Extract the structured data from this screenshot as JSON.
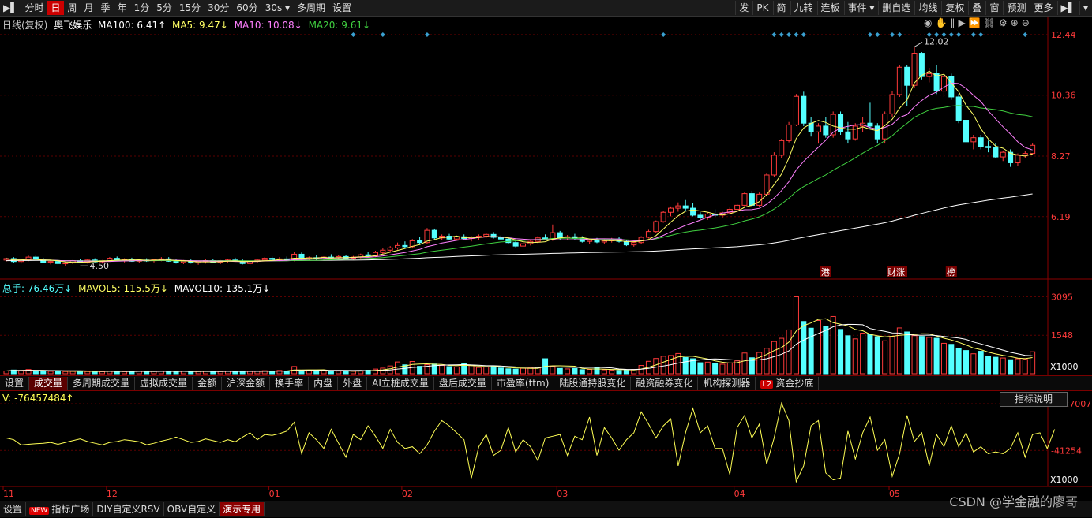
{
  "toolbar": {
    "left": [
      {
        "label": "▶▌",
        "icon": "replay-icon"
      },
      {
        "label": "分时"
      },
      {
        "label": "日",
        "active": true
      },
      {
        "label": "周"
      },
      {
        "label": "月"
      },
      {
        "label": "季"
      },
      {
        "label": "年"
      },
      {
        "label": "1分"
      },
      {
        "label": "5分"
      },
      {
        "label": "15分"
      },
      {
        "label": "30分"
      },
      {
        "label": "60分"
      },
      {
        "label": "30s ▾"
      },
      {
        "label": "多周期"
      },
      {
        "label": "设置"
      }
    ],
    "right": [
      {
        "label": "发"
      },
      {
        "label": "PK"
      },
      {
        "label": "简"
      },
      {
        "label": "九转"
      },
      {
        "label": "连板"
      },
      {
        "label": "事件 ▾"
      },
      {
        "label": "删自选"
      },
      {
        "label": "均线"
      },
      {
        "label": "复权"
      },
      {
        "label": "叠"
      },
      {
        "label": "窗"
      },
      {
        "label": "预测"
      },
      {
        "label": "更多"
      },
      {
        "label": "▶▌"
      },
      {
        "label": "▾"
      }
    ]
  },
  "main_info": {
    "period": "日线(复权)",
    "stock": "奥飞娱乐",
    "ma100": "MA100: 6.41↑",
    "ma5": "MA5: 9.47↓",
    "ma10": "MA10: 10.08↓",
    "ma20": "MA20: 9.61↓"
  },
  "volume_info": {
    "total": "总手: 76.46万↓",
    "mavol5": "MAVOL5: 115.5万↓",
    "mavol10": "MAVOL10: 135.1万↓"
  },
  "indicator_info": {
    "v": "V: -76457484↑"
  },
  "price_axis": [
    "12.44",
    "10.36",
    "8.27",
    "6.19"
  ],
  "volume_axis": [
    "3095",
    "1548",
    "X1000"
  ],
  "indicator_axis": [
    "+227007",
    "-41254",
    "X1000"
  ],
  "date_axis": [
    "11",
    "12",
    "01",
    "02",
    "03",
    "04",
    "05"
  ],
  "annotations": {
    "high": "12.02",
    "low": "4.50",
    "events": [
      "港",
      "财涨",
      "榜"
    ]
  },
  "tabs": [
    {
      "label": "设置"
    },
    {
      "label": "成交量",
      "active": true
    },
    {
      "label": "多周期成交量"
    },
    {
      "label": "虚拟成交量"
    },
    {
      "label": "金额"
    },
    {
      "label": "沪深金额"
    },
    {
      "label": "换手率"
    },
    {
      "label": "内盘"
    },
    {
      "label": "外盘"
    },
    {
      "label": "AI立桩成交量"
    },
    {
      "label": "盘后成交量"
    },
    {
      "label": "市盈率(ttm)"
    },
    {
      "label": "陆股通持股变化"
    },
    {
      "label": "融资融券变化"
    },
    {
      "label": "机构探测器"
    },
    {
      "label": "资金抄底",
      "badge": "L2"
    }
  ],
  "indicator_button": "指标说明",
  "bottom_tabs": [
    {
      "label": "设置"
    },
    {
      "label": "指标广场",
      "badge": "NEW"
    },
    {
      "label": "DIY自定义RSV"
    },
    {
      "label": "OBV自定义"
    },
    {
      "label": "演示专用",
      "active": true
    }
  ],
  "watermark": "CSDN @学金融的廖哥",
  "colors": {
    "up": "#ff3a3a",
    "down": "#54ffff",
    "ma5": "#ffff64",
    "ma10": "#ff80ff",
    "ma20": "#40d040",
    "ma100": "#ffffff",
    "axis": "#8b0000",
    "indicator": "#ffff55",
    "marker": "#3aa0d0"
  },
  "chart_data": {
    "type": "candlestick",
    "price_ylim": [
      4.1,
      12.6
    ],
    "volume_ylim": [
      0,
      3300
    ],
    "indicator_ylim": [
      -230000,
      227007
    ],
    "candles": [
      [
        4.7,
        4.78,
        4.65,
        4.75
      ],
      [
        4.75,
        4.8,
        4.6,
        4.65
      ],
      [
        4.65,
        4.72,
        4.58,
        4.7
      ],
      [
        4.7,
        4.85,
        4.66,
        4.8
      ],
      [
        4.8,
        4.88,
        4.7,
        4.72
      ],
      [
        4.72,
        4.78,
        4.6,
        4.62
      ],
      [
        4.62,
        4.68,
        4.55,
        4.65
      ],
      [
        4.65,
        4.7,
        4.55,
        4.58
      ],
      [
        4.58,
        4.64,
        4.5,
        4.6
      ],
      [
        4.6,
        4.7,
        4.56,
        4.68
      ],
      [
        4.68,
        4.74,
        4.6,
        4.62
      ],
      [
        4.62,
        4.72,
        4.58,
        4.7
      ],
      [
        4.7,
        4.76,
        4.62,
        4.64
      ],
      [
        4.64,
        4.7,
        4.58,
        4.68
      ],
      [
        4.68,
        4.8,
        4.64,
        4.76
      ],
      [
        4.76,
        4.82,
        4.66,
        4.7
      ],
      [
        4.7,
        4.76,
        4.62,
        4.72
      ],
      [
        4.72,
        4.78,
        4.64,
        4.66
      ],
      [
        4.66,
        4.74,
        4.6,
        4.7
      ],
      [
        4.7,
        4.76,
        4.64,
        4.68
      ],
      [
        4.68,
        4.74,
        4.62,
        4.72
      ],
      [
        4.72,
        4.8,
        4.66,
        4.74
      ],
      [
        4.74,
        4.8,
        4.64,
        4.66
      ],
      [
        4.66,
        4.72,
        4.58,
        4.62
      ],
      [
        4.62,
        4.7,
        4.56,
        4.66
      ],
      [
        4.66,
        4.72,
        4.58,
        4.6
      ],
      [
        4.6,
        4.68,
        4.54,
        4.64
      ],
      [
        4.64,
        4.72,
        4.58,
        4.68
      ],
      [
        4.68,
        4.74,
        4.6,
        4.62
      ],
      [
        4.62,
        4.7,
        4.56,
        4.68
      ],
      [
        4.68,
        4.75,
        4.62,
        4.7
      ],
      [
        4.7,
        4.78,
        4.64,
        4.66
      ],
      [
        4.66,
        4.72,
        4.55,
        4.58
      ],
      [
        4.58,
        4.68,
        4.52,
        4.66
      ],
      [
        4.66,
        4.74,
        4.6,
        4.7
      ],
      [
        4.7,
        4.8,
        4.66,
        4.76
      ],
      [
        4.76,
        4.82,
        4.68,
        4.72
      ],
      [
        4.72,
        4.8,
        4.66,
        4.74
      ],
      [
        4.74,
        4.82,
        4.68,
        4.7
      ],
      [
        4.7,
        4.98,
        4.66,
        4.9
      ],
      [
        4.9,
        4.96,
        4.7,
        4.74
      ],
      [
        4.74,
        4.82,
        4.68,
        4.78
      ],
      [
        4.78,
        4.86,
        4.7,
        4.74
      ],
      [
        4.74,
        4.82,
        4.68,
        4.8
      ],
      [
        4.8,
        4.9,
        4.74,
        4.78
      ],
      [
        4.78,
        4.86,
        4.7,
        4.82
      ],
      [
        4.82,
        4.88,
        4.74,
        4.76
      ],
      [
        4.76,
        4.84,
        4.7,
        4.8
      ],
      [
        4.8,
        4.92,
        4.76,
        4.88
      ],
      [
        4.88,
        4.98,
        4.8,
        4.84
      ],
      [
        4.84,
        5.02,
        4.8,
        4.96
      ],
      [
        4.96,
        5.1,
        4.9,
        5.04
      ],
      [
        5.04,
        5.18,
        4.98,
        5.12
      ],
      [
        5.12,
        5.3,
        5.06,
        5.2
      ],
      [
        5.2,
        5.34,
        5.1,
        5.16
      ],
      [
        5.16,
        5.42,
        5.1,
        5.36
      ],
      [
        5.36,
        5.5,
        5.24,
        5.3
      ],
      [
        5.3,
        5.8,
        5.26,
        5.72
      ],
      [
        5.72,
        5.78,
        5.4,
        5.46
      ],
      [
        5.46,
        5.58,
        5.38,
        5.52
      ],
      [
        5.52,
        5.6,
        5.38,
        5.42
      ],
      [
        5.42,
        5.54,
        5.36,
        5.5
      ],
      [
        5.5,
        5.58,
        5.4,
        5.44
      ],
      [
        5.44,
        5.52,
        5.34,
        5.48
      ],
      [
        5.48,
        5.58,
        5.4,
        5.52
      ],
      [
        5.52,
        5.64,
        5.46,
        5.58
      ],
      [
        5.58,
        5.66,
        5.44,
        5.48
      ],
      [
        5.48,
        5.56,
        5.38,
        5.42
      ],
      [
        5.42,
        5.5,
        5.26,
        5.3
      ],
      [
        5.3,
        5.36,
        5.14,
        5.18
      ],
      [
        5.18,
        5.3,
        5.12,
        5.26
      ],
      [
        5.26,
        5.38,
        5.2,
        5.34
      ],
      [
        5.34,
        5.52,
        5.28,
        5.46
      ],
      [
        5.46,
        5.58,
        5.38,
        5.4
      ],
      [
        5.4,
        5.92,
        5.36,
        5.64
      ],
      [
        5.64,
        5.7,
        5.4,
        5.46
      ],
      [
        5.46,
        5.56,
        5.38,
        5.5
      ],
      [
        5.5,
        5.6,
        5.4,
        5.44
      ],
      [
        5.44,
        5.52,
        5.3,
        5.34
      ],
      [
        5.34,
        5.44,
        5.26,
        5.38
      ],
      [
        5.38,
        5.46,
        5.28,
        5.32
      ],
      [
        5.32,
        5.42,
        5.24,
        5.36
      ],
      [
        5.36,
        5.46,
        5.3,
        5.42
      ],
      [
        5.42,
        5.5,
        5.3,
        5.34
      ],
      [
        5.34,
        5.4,
        5.18,
        5.22
      ],
      [
        5.22,
        5.34,
        5.16,
        5.3
      ],
      [
        5.3,
        5.52,
        5.26,
        5.48
      ],
      [
        5.48,
        5.74,
        5.44,
        5.68
      ],
      [
        5.68,
        6.06,
        5.64,
        6.02
      ],
      [
        6.02,
        6.4,
        5.98,
        6.34
      ],
      [
        6.34,
        6.54,
        6.2,
        6.48
      ],
      [
        6.48,
        6.68,
        6.36,
        6.56
      ],
      [
        6.56,
        6.76,
        6.4,
        6.48
      ],
      [
        6.48,
        6.66,
        6.2,
        6.24
      ],
      [
        6.24,
        6.34,
        6.1,
        6.16
      ],
      [
        6.16,
        6.34,
        6.08,
        6.28
      ],
      [
        6.28,
        6.44,
        6.18,
        6.24
      ],
      [
        6.24,
        6.36,
        6.14,
        6.32
      ],
      [
        6.32,
        6.5,
        6.26,
        6.44
      ],
      [
        6.44,
        6.62,
        6.34,
        6.58
      ],
      [
        6.58,
        7.04,
        6.52,
        6.98
      ],
      [
        6.98,
        7.08,
        6.52,
        6.58
      ],
      [
        6.58,
        7.02,
        6.52,
        6.96
      ],
      [
        6.96,
        7.7,
        6.9,
        7.62
      ],
      [
        7.62,
        8.4,
        7.56,
        8.3
      ],
      [
        8.3,
        8.86,
        8.2,
        8.8
      ],
      [
        8.8,
        9.44,
        8.74,
        9.34
      ],
      [
        9.34,
        10.4,
        9.3,
        10.32
      ],
      [
        10.32,
        10.48,
        9.3,
        9.4
      ],
      [
        9.4,
        9.6,
        8.94,
        9.1
      ],
      [
        9.1,
        9.4,
        8.7,
        9.3
      ],
      [
        9.3,
        9.6,
        8.9,
        9.0
      ],
      [
        9.0,
        9.8,
        8.9,
        9.7
      ],
      [
        9.7,
        9.8,
        9.0,
        9.1
      ],
      [
        9.1,
        9.44,
        8.7,
        8.86
      ],
      [
        8.86,
        9.4,
        8.8,
        9.3
      ],
      [
        9.3,
        9.6,
        9.1,
        9.4
      ],
      [
        9.4,
        10.1,
        9.2,
        9.3
      ],
      [
        9.3,
        9.4,
        8.7,
        8.86
      ],
      [
        8.86,
        9.8,
        8.7,
        9.72
      ],
      [
        9.72,
        10.5,
        9.6,
        10.38
      ],
      [
        10.38,
        11.4,
        10.3,
        11.32
      ],
      [
        11.32,
        11.4,
        10.0,
        10.7
      ],
      [
        10.7,
        12.02,
        10.6,
        11.8
      ],
      [
        11.8,
        11.84,
        10.9,
        11.0
      ],
      [
        11.0,
        11.3,
        10.8,
        11.1
      ],
      [
        11.1,
        11.4,
        10.4,
        10.5
      ],
      [
        10.5,
        11.16,
        10.3,
        11.0
      ],
      [
        11.0,
        11.1,
        10.2,
        10.3
      ],
      [
        10.3,
        10.4,
        9.4,
        9.5
      ],
      [
        9.5,
        9.6,
        8.6,
        8.76
      ],
      [
        8.76,
        9.0,
        8.5,
        8.9
      ],
      [
        8.9,
        9.0,
        8.5,
        8.6
      ],
      [
        8.6,
        8.8,
        8.4,
        8.56
      ],
      [
        8.56,
        8.7,
        8.2,
        8.24
      ],
      [
        8.24,
        8.46,
        8.1,
        8.4
      ],
      [
        8.4,
        8.5,
        7.9,
        8.04
      ],
      [
        8.04,
        8.36,
        7.94,
        8.3
      ],
      [
        8.3,
        8.44,
        8.2,
        8.36
      ],
      [
        8.36,
        8.7,
        8.3,
        8.64
      ]
    ],
    "volume": [
      112,
      148,
      132,
      168,
      121,
      104,
      96,
      118,
      88,
      92,
      104,
      87,
      96,
      82,
      106,
      93,
      84,
      98,
      102,
      89,
      95,
      104,
      92,
      86,
      97,
      84,
      91,
      103,
      94,
      88,
      101,
      96,
      112,
      92,
      98,
      121,
      106,
      132,
      98,
      289,
      142,
      118,
      126,
      112,
      92,
      107,
      115,
      98,
      124,
      142,
      186,
      224,
      312,
      472,
      356,
      492,
      298,
      362,
      388,
      332,
      286,
      274,
      412,
      328,
      252,
      268,
      302,
      228,
      196,
      184,
      218,
      232,
      252,
      602,
      286,
      212,
      192,
      208,
      162,
      174,
      222,
      158,
      146,
      132,
      148,
      172,
      332,
      498,
      612,
      702,
      732,
      812,
      652,
      602,
      442,
      466,
      422,
      382,
      432,
      516,
      832,
      642,
      856,
      1024,
      1296,
      1426,
      1762,
      3095,
      2102,
      1832,
      2142,
      1892,
      2302,
      1782,
      1528,
      1402,
      1632,
      1582,
      1492,
      1324,
      1502,
      1842,
      1682,
      1532,
      1502,
      1462,
      1426,
      1224,
      1182,
      1026,
      932,
      802,
      902,
      686,
      662,
      632,
      564,
      602,
      576,
      882
    ],
    "indicator": [
      30000,
      20000,
      -10000,
      -6000,
      -3000,
      0,
      5000,
      -6000,
      5000,
      15000,
      25000,
      10000,
      0,
      -10000,
      5000,
      10000,
      20000,
      15000,
      8000,
      -9000,
      0,
      12000,
      22000,
      35000,
      20000,
      5000,
      10000,
      25000,
      15000,
      5000,
      20000,
      8000,
      35000,
      60000,
      20000,
      50000,
      45000,
      55000,
      70000,
      120000,
      -60000,
      60000,
      20000,
      -30000,
      80000,
      0,
      -80000,
      50000,
      20000,
      100000,
      40000,
      -30000,
      80000,
      5000,
      -30000,
      -20000,
      -60000,
      -10000,
      70000,
      130000,
      100000,
      60000,
      20000,
      -200000,
      -20000,
      50000,
      -70000,
      -40000,
      90000,
      -50000,
      20000,
      -20000,
      -100000,
      30000,
      40000,
      50000,
      -70000,
      40000,
      20000,
      150000,
      -70000,
      90000,
      30000,
      -40000,
      20000,
      60000,
      180000,
      110000,
      30000,
      100000,
      140000,
      -130000,
      60000,
      200000,
      60000,
      100000,
      -30000,
      -30000,
      -180000,
      90000,
      160000,
      30000,
      110000,
      -120000,
      30000,
      230000,
      130000,
      -220000,
      -130000,
      100000,
      130000,
      -170000,
      -210000,
      -200000,
      70000,
      -90000,
      60000,
      150000,
      -40000,
      20000,
      -190000,
      -60000,
      160000,
      10000,
      60000,
      -130000,
      50000,
      -20000,
      100000,
      -20000,
      60000,
      -50000,
      -20000,
      -60000,
      -50000,
      -60000,
      -30000,
      60000,
      -80000,
      50000,
      60000,
      -30000,
      80000
    ]
  }
}
